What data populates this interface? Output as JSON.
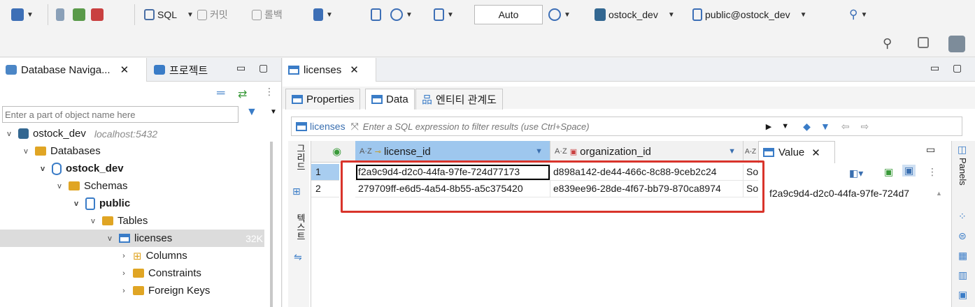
{
  "toolbar": {
    "sql_label": "SQL",
    "commit_label": "커밋",
    "rollback_label": "롤백",
    "auto_value": "Auto",
    "connection_label": "ostock_dev",
    "schema_label": "public@ostock_dev"
  },
  "left_panel": {
    "tabs": [
      {
        "label": "Database Naviga..."
      },
      {
        "label": "프로젝트"
      }
    ],
    "filter_placeholder": "Enter a part of object name here",
    "tree": [
      {
        "label": "ostock_dev",
        "sub": "localhost:5432"
      },
      {
        "label": "Databases"
      },
      {
        "label": "ostock_dev"
      },
      {
        "label": "Schemas"
      },
      {
        "label": "public"
      },
      {
        "label": "Tables"
      },
      {
        "label": "licenses",
        "size": "32K"
      },
      {
        "label": "Columns"
      },
      {
        "label": "Constraints"
      },
      {
        "label": "Foreign Keys"
      }
    ]
  },
  "editor": {
    "tab_label": "licenses",
    "subtabs": [
      {
        "label": "Properties"
      },
      {
        "label": "Data"
      },
      {
        "label": "엔티티 관계도"
      }
    ],
    "filter_table": "licenses",
    "filter_placeholder": "Enter a SQL expression to filter results (use Ctrl+Space)",
    "side_labels": {
      "grid": "그리드",
      "text": "텍스트"
    },
    "columns": [
      {
        "label": "license_id"
      },
      {
        "label": "organization_id"
      },
      {
        "label": "A-Z"
      }
    ],
    "rows": [
      {
        "num": "1",
        "license_id": "f2a9c9d4-d2c0-44fa-97fe-724d77173",
        "organization_id": "d898a142-de44-466c-8c88-9ceb2c24",
        "extra": "So"
      },
      {
        "num": "2",
        "license_id": "279709ff-e6d5-4a54-8b55-a5c375420",
        "organization_id": "e839ee96-28de-4f67-bb79-870ca8974",
        "extra": "So"
      }
    ],
    "value_panel": {
      "title": "Value",
      "value": "f2a9c9d4-d2c0-44fa-97fe-724d7"
    },
    "right_bar_label": "Panels"
  },
  "colors": {
    "highlight": "#d9342b",
    "selected_row": "#a8cdf0",
    "header_selected": "#9ec7ee"
  }
}
